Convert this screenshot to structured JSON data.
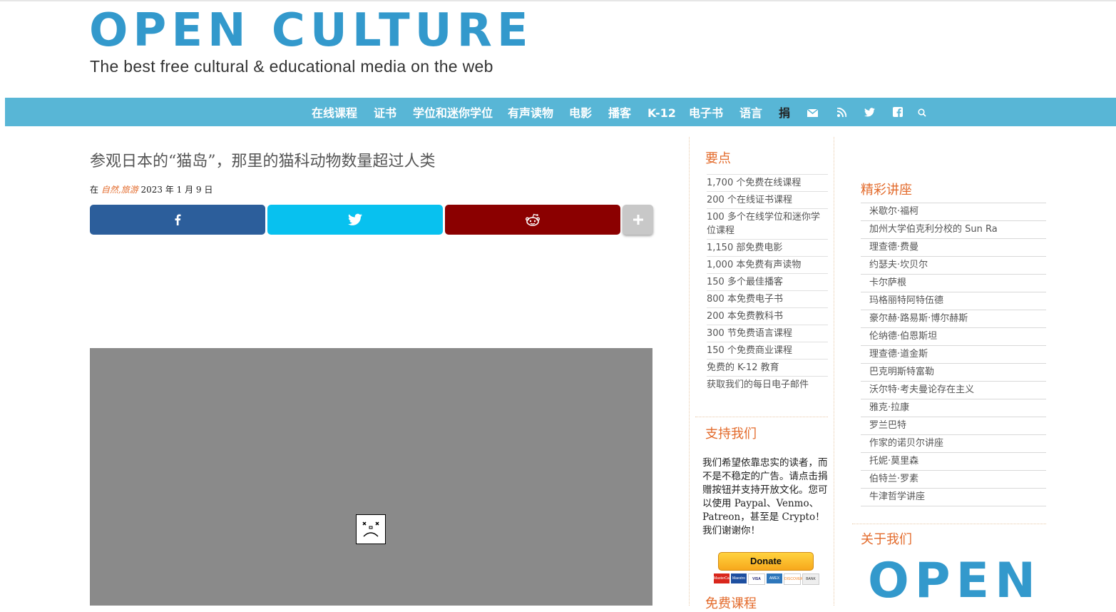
{
  "brand": {
    "logo": "OPEN CULTURE",
    "tagline": "The best free cultural & educational media on the web",
    "color": "#3399cc"
  },
  "nav": {
    "items": [
      "在线课程",
      "证书",
      "学位和迷你学位",
      "有声读物",
      "电影",
      "播客",
      "K-12",
      "电子书",
      "语言",
      "捐"
    ],
    "icons": [
      "mail-icon",
      "rss-icon",
      "twitter-icon",
      "facebook-icon",
      "search-icon"
    ],
    "bar_color": "#58b6d6"
  },
  "article": {
    "title": "参观日本的“猫岛”，那里的猫科动物数量超过人类",
    "byline_prefix": "在",
    "categories": "自然,旅游",
    "date": "2023 年 1 月 9 日"
  },
  "share": {
    "buttons": [
      "facebook",
      "twitter",
      "reddit",
      "more"
    ],
    "colors": {
      "facebook": "#2c5e9b",
      "twitter": "#08c1ef",
      "reddit": "#8b0000",
      "more": "#c8c8c8"
    }
  },
  "sidebar1": {
    "highlights_title": "要点",
    "highlights": [
      "1,700 个免费在线课程",
      "200 个在线证书课程",
      "100 多个在线学位和迷你学位课程",
      "1,150 部免费电影",
      "1,000 本免费有声读物",
      "150 多个最佳播客",
      "800 本免费电子书",
      "200 本免费教科书",
      "300 节免费语言课程",
      "150 个免费商业课程",
      "免费的 K-12 教育",
      "获取我们的每日电子邮件"
    ],
    "support_title": "支持我们",
    "support_text": "我们希望依靠忠实的读者，而不是不稳定的广告。请点击捐赠按钮并支持开放文化。您可以使用 Paypal、Venmo、Patreon，甚至是 Crypto！我们谢谢你！",
    "donate_label": "Donate",
    "cards": [
      "MasterCard",
      "Maestro",
      "VISA",
      "AMEX",
      "DISCOVER",
      "BANK"
    ],
    "free_courses_title": "免费课程"
  },
  "sidebar2": {
    "lectures_title": "精彩讲座",
    "lectures": [
      "米歇尔·福柯",
      "加州大学伯克利分校的 Sun Ra",
      "理查德·费曼",
      "约瑟夫·坎贝尔",
      "卡尔萨根",
      "玛格丽特阿特伍德",
      "豪尔赫·路易斯·博尔赫斯",
      "伦纳德·伯恩斯坦",
      "理查德·道金斯",
      "巴克明斯特富勒",
      "沃尔特·考夫曼论存在主义",
      "雅克·拉康",
      "罗兰巴特",
      "作家的诺贝尔讲座",
      "托妮·莫里森",
      "伯特兰·罗素",
      "牛津哲学讲座"
    ],
    "about_title": "关于我们",
    "about_logo": "OPEN"
  },
  "accent_color": "#e36b2c"
}
